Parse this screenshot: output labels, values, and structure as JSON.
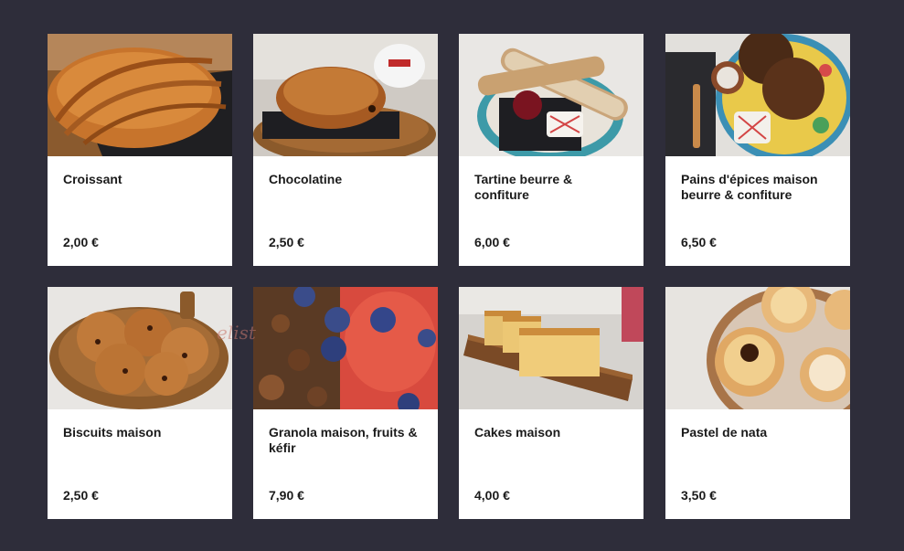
{
  "products": [
    {
      "name": "Croissant",
      "price": "2,00 €",
      "image_icon": "croissant-photo"
    },
    {
      "name": "Chocolatine",
      "price": "2,50 €",
      "image_icon": "chocolatine-photo"
    },
    {
      "name": "Tartine beurre & confiture",
      "price": "6,00 €",
      "image_icon": "tartine-photo"
    },
    {
      "name": "Pains d'épices maison beurre & confiture",
      "price": "6,50 €",
      "image_icon": "pain-epices-photo"
    },
    {
      "name": "Biscuits maison",
      "price": "2,50 €",
      "image_icon": "biscuits-photo"
    },
    {
      "name": "Granola maison, fruits & kéfir",
      "price": "7,90 €",
      "image_icon": "granola-photo"
    },
    {
      "name": "Cakes maison",
      "price": "4,00 €",
      "image_icon": "cakes-photo"
    },
    {
      "name": "Pastel de nata",
      "price": "3,50 €",
      "image_icon": "pastel-de-nata-photo"
    }
  ],
  "watermark": "elist",
  "colors": {
    "background": "#2e2d3a",
    "card": "#ffffff",
    "text": "#1b1b1b"
  }
}
